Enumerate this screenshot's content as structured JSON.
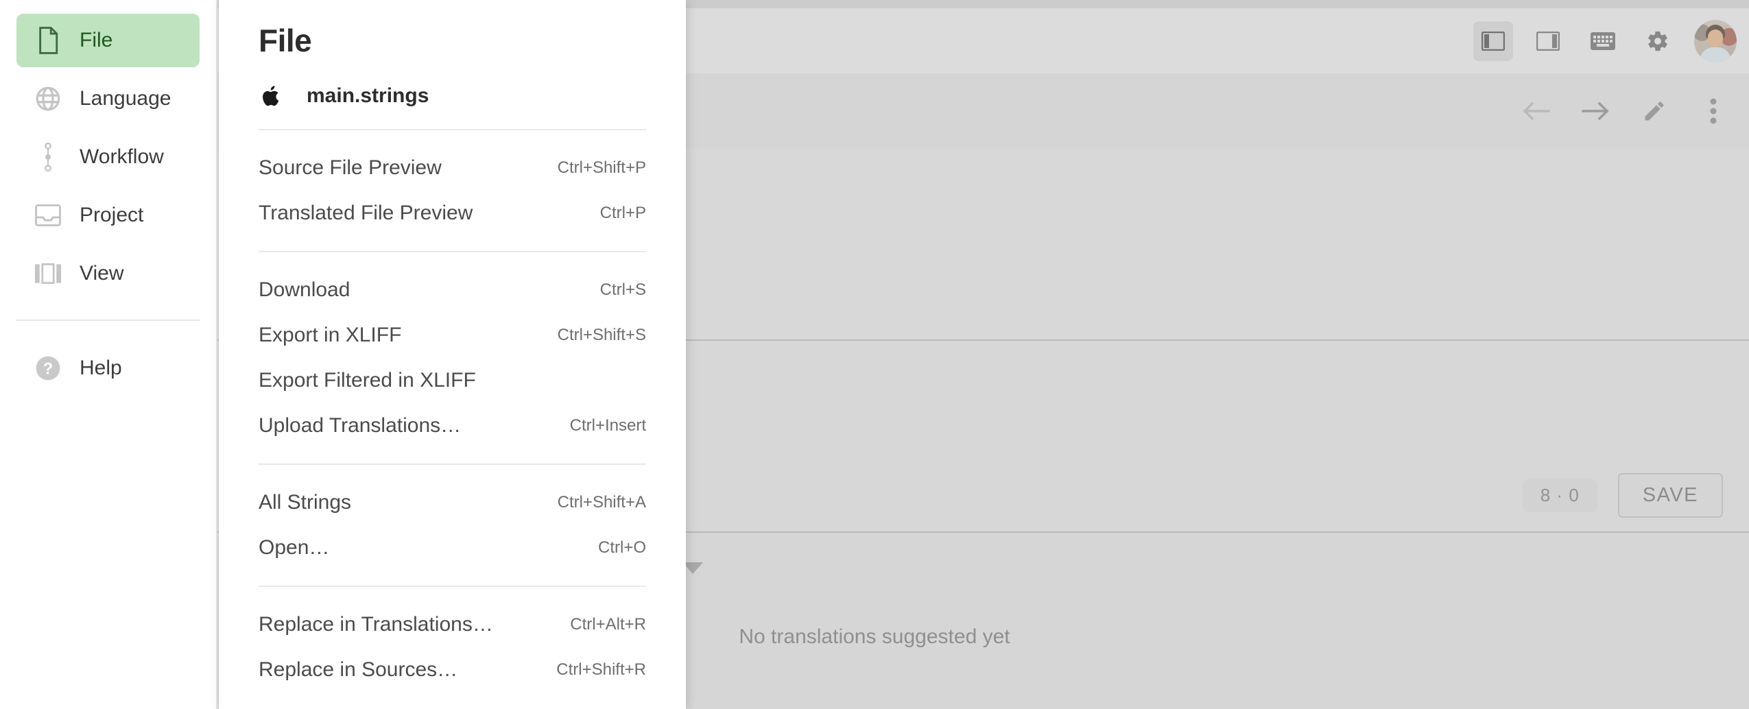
{
  "sidebar": {
    "items": [
      {
        "label": "File",
        "icon": "file-icon",
        "selected": true
      },
      {
        "label": "Language",
        "icon": "globe-icon",
        "selected": false
      },
      {
        "label": "Workflow",
        "icon": "workflow-icon",
        "selected": false
      },
      {
        "label": "Project",
        "icon": "project-icon",
        "selected": false
      },
      {
        "label": "View",
        "icon": "view-icon",
        "selected": false
      }
    ],
    "help": {
      "label": "Help",
      "icon": "help-icon"
    }
  },
  "menu_panel": {
    "title": "File",
    "file": {
      "name": "main.strings",
      "icon": "apple-icon"
    },
    "groups": [
      {
        "items": [
          {
            "label": "Source File Preview",
            "shortcut": "Ctrl+Shift+P"
          },
          {
            "label": "Translated File Preview",
            "shortcut": "Ctrl+P"
          }
        ]
      },
      {
        "items": [
          {
            "label": "Download",
            "shortcut": "Ctrl+S"
          },
          {
            "label": "Export in XLIFF",
            "shortcut": "Ctrl+Shift+S"
          },
          {
            "label": "Export Filtered in XLIFF",
            "shortcut": ""
          },
          {
            "label": "Upload Translations…",
            "shortcut": "Ctrl+Insert"
          }
        ]
      },
      {
        "items": [
          {
            "label": "All Strings",
            "shortcut": "Ctrl+Shift+A"
          },
          {
            "label": "Open…",
            "shortcut": "Ctrl+O"
          }
        ]
      },
      {
        "items": [
          {
            "label": "Replace in Translations…",
            "shortcut": "Ctrl+Alt+R"
          },
          {
            "label": "Replace in Sources…",
            "shortcut": "Ctrl+Shift+R"
          }
        ]
      }
    ]
  },
  "toolbar": {
    "icons": [
      {
        "name": "left-panel-toggle-icon",
        "active": true
      },
      {
        "name": "right-panel-toggle-icon",
        "active": false
      },
      {
        "name": "keyboard-icon",
        "active": false
      },
      {
        "name": "settings-gear-icon",
        "active": false
      }
    ],
    "avatar": "user-avatar"
  },
  "secondary_toolbar": {
    "icons": [
      {
        "name": "back-arrow-icon",
        "disabled": true
      },
      {
        "name": "forward-arrow-icon",
        "disabled": false
      },
      {
        "name": "edit-pencil-icon",
        "disabled": false
      },
      {
        "name": "more-vert-icon",
        "disabled": false
      }
    ]
  },
  "editor": {
    "count_badge": "8 · 0",
    "save_label": "SAVE"
  },
  "suggestions": {
    "empty_text": "No translations suggested yet"
  },
  "colors": {
    "accent_green_bg": "#bfe2bf",
    "accent_green_text": "#1d5a20",
    "panel_bg": "#ffffff",
    "app_bg": "#d7d7d7"
  }
}
